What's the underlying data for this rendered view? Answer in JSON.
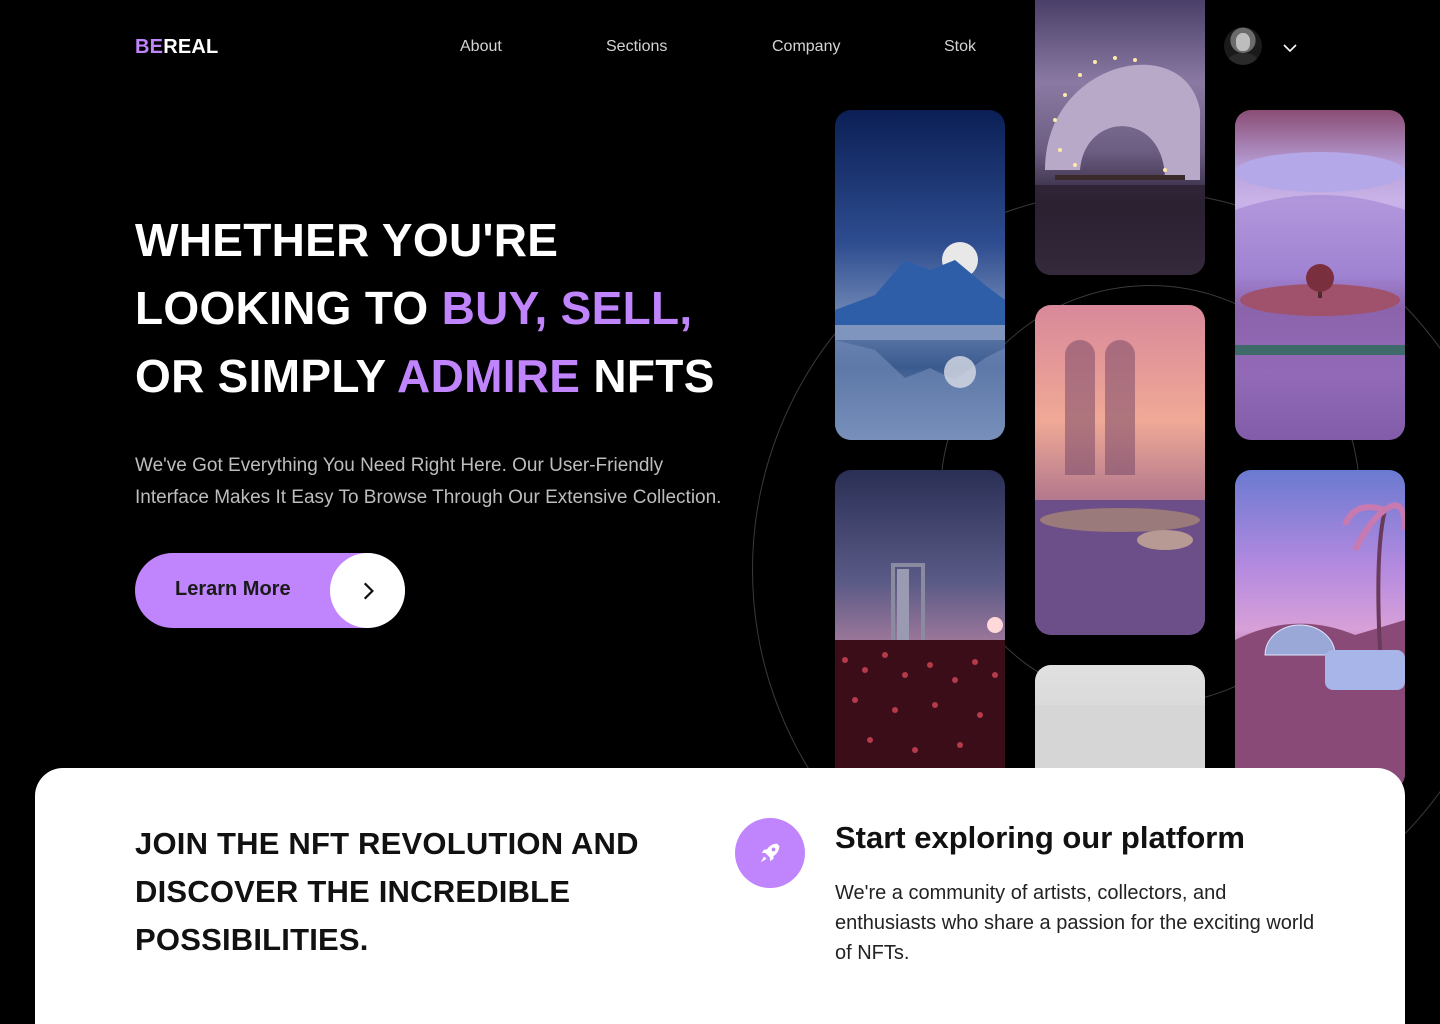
{
  "brand": {
    "logo_part1": "BE",
    "logo_part2": "REAL"
  },
  "nav": {
    "items": [
      {
        "label": "About"
      },
      {
        "label": "Sections"
      },
      {
        "label": "Company"
      },
      {
        "label": "Stok"
      }
    ]
  },
  "user": {
    "avatar_icon": "avatar",
    "menu_icon": "chevron-down-icon"
  },
  "hero": {
    "line1": "WHETHER YOU'RE",
    "line2_a": "LOOKING TO ",
    "line2_hl": "BUY, SELL,",
    "line3_a": "OR SIMPLY ",
    "line3_hl": "ADMIRE",
    "line3_b": " NFTS",
    "subtitle_line1": "We've Got Everything You Need Right Here. Our User-Friendly",
    "subtitle_line2": "Interface Makes It Easy To Browse Through Our Extensive Collection.",
    "cta_label": "Lerarn More",
    "cta_icon": "chevron-right-icon"
  },
  "gallery": {
    "cards": [
      {
        "name": "moon-mountain-art"
      },
      {
        "name": "door-field-art"
      },
      {
        "name": "arch-lights-art"
      },
      {
        "name": "pink-arches-art"
      },
      {
        "name": "white-fog-art"
      },
      {
        "name": "tree-island-art"
      },
      {
        "name": "palm-dome-art"
      }
    ]
  },
  "panel": {
    "title": "JOIN THE NFT REVOLUTION AND DISCOVER THE INCREDIBLE POSSIBILITIES.",
    "icon": "rocket-icon",
    "heading": "Start exploring our platform",
    "text": "We're a community of artists, collectors, and enthusiasts who share a passion for the exciting world of NFTs."
  },
  "colors": {
    "accent": "#c084fc",
    "background": "#000000",
    "panel": "#ffffff"
  }
}
